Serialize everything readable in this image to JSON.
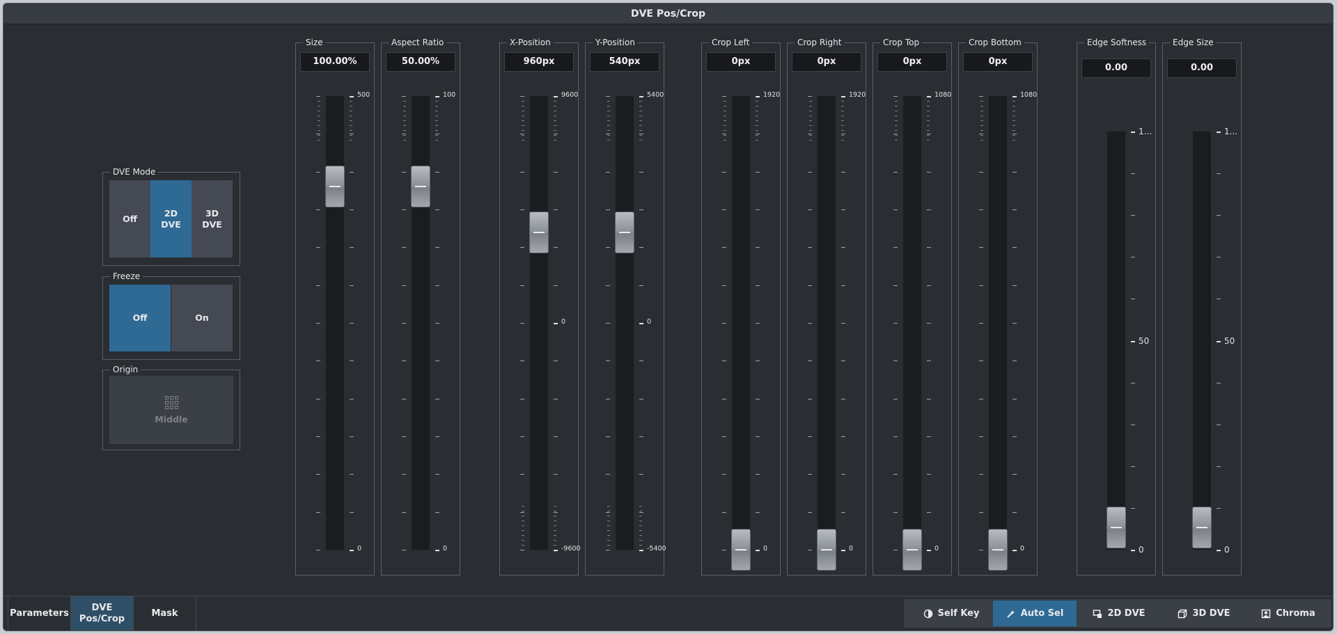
{
  "title": "DVE Pos/Crop",
  "dve_mode": {
    "title": "DVE Mode",
    "options": [
      "Off",
      "2D\nDVE",
      "3D\nDVE"
    ],
    "selected": "2D DVE"
  },
  "freeze": {
    "title": "Freeze",
    "options": [
      "Off",
      "On"
    ],
    "selected": "Off"
  },
  "origin": {
    "title": "Origin",
    "value": "Middle"
  },
  "sliders": [
    {
      "name": "size",
      "label": "Size",
      "value": "100.00%",
      "max_label": "500",
      "min_label": "0",
      "position": 0.2
    },
    {
      "name": "aspect-ratio",
      "label": "Aspect Ratio",
      "value": "50.00%",
      "max_label": "100",
      "min_label": "0",
      "position": 0.2
    },
    {
      "name": "x-position",
      "label": "X-Position",
      "value": "960px",
      "max_label": "9600",
      "mid_label": "0",
      "min_label": "-9600",
      "position": 0.3
    },
    {
      "name": "y-position",
      "label": "Y-Position",
      "value": "540px",
      "max_label": "5400",
      "mid_label": "0",
      "min_label": "-5400",
      "position": 0.3
    },
    {
      "name": "crop-left",
      "label": "Crop Left",
      "value": "0px",
      "max_label": "1920",
      "min_label": "0",
      "position": 1.0
    },
    {
      "name": "crop-right",
      "label": "Crop Right",
      "value": "0px",
      "max_label": "1920",
      "min_label": "0",
      "position": 1.0
    },
    {
      "name": "crop-top",
      "label": "Crop Top",
      "value": "0px",
      "max_label": "1080",
      "min_label": "0",
      "position": 1.0
    },
    {
      "name": "crop-bottom",
      "label": "Crop Bottom",
      "value": "0px",
      "max_label": "1080",
      "min_label": "0",
      "position": 1.0
    },
    {
      "name": "edge-softness",
      "label": "Edge Softness",
      "value": "0.00",
      "max_label": "1...",
      "mid_label": "50",
      "min_label": "0",
      "position": 1.0
    },
    {
      "name": "edge-size",
      "label": "Edge Size",
      "value": "0.00",
      "max_label": "1...",
      "mid_label": "50",
      "min_label": "0",
      "position": 1.0
    }
  ],
  "footer": {
    "tabs": [
      "Parameters",
      "DVE\nPos/Crop",
      "Mask"
    ],
    "active_tab": "DVE Pos/Crop",
    "buttons": [
      {
        "label": "Self Key",
        "icon": "half-circle-icon"
      },
      {
        "label": "Auto Sel",
        "icon": "wand-icon",
        "active": true
      },
      {
        "label": "2D DVE",
        "icon": "2d-dve-icon"
      },
      {
        "label": "3D DVE",
        "icon": "3d-dve-icon"
      },
      {
        "label": "Chroma",
        "icon": "chroma-icon"
      }
    ]
  },
  "colors": {
    "accent": "#2e6a93",
    "panel": "#2a2d32",
    "button": "#454953"
  }
}
